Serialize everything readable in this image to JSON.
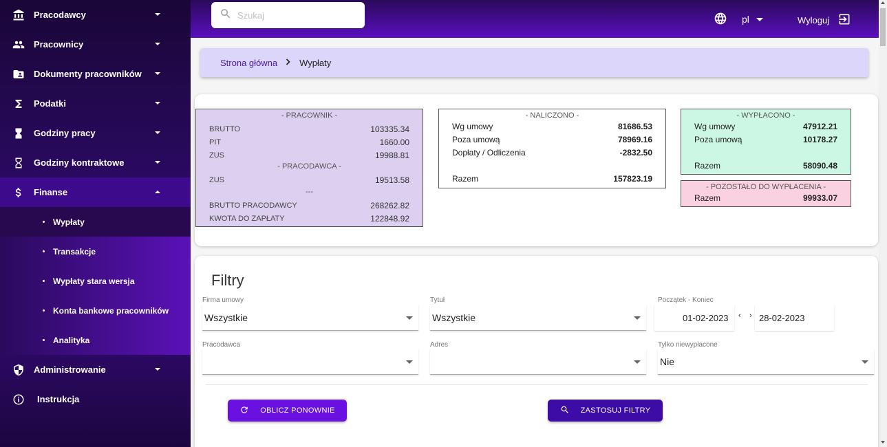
{
  "sidebar": {
    "items": [
      {
        "label": "Pracodawcy",
        "icon": "bank-icon"
      },
      {
        "label": "Pracownicy",
        "icon": "people-icon"
      },
      {
        "label": "Dokumenty pracowników",
        "icon": "folder-person-icon"
      },
      {
        "label": "Podatki",
        "icon": "sigma-icon"
      },
      {
        "label": "Godziny pracy",
        "icon": "hourglass-filled-icon"
      },
      {
        "label": "Godziny kontraktowe",
        "icon": "hourglass-outline-icon"
      },
      {
        "label": "Finanse",
        "icon": "dollar-icon"
      }
    ],
    "finanse_sub": [
      {
        "label": "Wypłaty"
      },
      {
        "label": "Transakcje"
      },
      {
        "label": "Wypłaty stara wersja"
      },
      {
        "label": "Konta bankowe pracowników"
      },
      {
        "label": "Analityka"
      }
    ],
    "bottom": [
      {
        "label": "Administrowanie",
        "icon": "shield-icon"
      },
      {
        "label": "Instrukcja",
        "icon": "info-icon"
      }
    ]
  },
  "topbar": {
    "search_placeholder": "Szukaj",
    "language": "pl",
    "logout_label": "Wyloguj"
  },
  "breadcrumb": {
    "home": "Strona główna",
    "current": "Wypłaty"
  },
  "summary": {
    "employee": {
      "header": "- PRACOWNIK -",
      "brutto_label": "BRUTTO",
      "brutto": "103335.34",
      "pit_label": "PIT",
      "pit": "1660.00",
      "zus_label": "ZUS",
      "zus": "19988.81",
      "employer_header": "- PRACODAWCA -",
      "employer_zus_label": "ZUS",
      "employer_zus": "19513.58",
      "separator": "---",
      "brutto_employer_label": "BRUTTO PRACODAWCY",
      "brutto_employer": "268262.82",
      "amount_due_label": "KWOTA DO ZAPŁATY",
      "amount_due": "122848.92"
    },
    "accrued": {
      "header": "- NALICZONO -",
      "contract_label": "Wg umowy",
      "contract": "81686.53",
      "off_contract_label": "Poza umową",
      "off_contract": "78969.16",
      "adjustments_label": "Dopłaty / Odliczenia",
      "adjustments": "-2832.50",
      "total_label": "Razem",
      "total": "157823.19"
    },
    "paid": {
      "header": "- WYPŁACONO -",
      "contract_label": "Wg umowy",
      "contract": "47912.21",
      "off_contract_label": "Poza umową",
      "off_contract": "10178.27",
      "total_label": "Razem",
      "total": "58090.48"
    },
    "remaining": {
      "header": "- POZOSTAŁO DO WYPŁACENIA -",
      "total_label": "Razem",
      "total": "99933.07"
    }
  },
  "filters": {
    "title": "Filtry",
    "company_label": "Firma umowy",
    "company_value": "Wszystkie",
    "title_label": "Tytuł",
    "title_value": "Wszystkie",
    "range_label": "Początek - Koniec",
    "date_start": "01-02-2023",
    "date_end": "28-02-2023",
    "date_prev": "‹",
    "date_next": "›",
    "employer_label": "Pracodawca",
    "employer_value": "",
    "address_label": "Adres",
    "address_value": "",
    "unpaid_label": "Tylko niewypłacone",
    "unpaid_value": "Nie",
    "recalc_button": "OBLICZ PONOWNIE",
    "apply_button": "ZASTOSUJ FILTRY"
  }
}
